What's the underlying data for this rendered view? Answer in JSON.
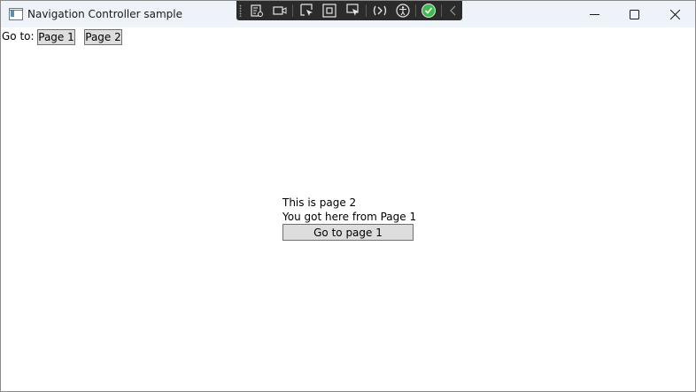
{
  "window": {
    "title": "Navigation Controller sample"
  },
  "debug_toolbar": {
    "icons": [
      "live-visual-tree-icon",
      "record-icon",
      "select-element-icon",
      "display-layout-adorners-icon",
      "track-focus-icon",
      "hot-reload-icon",
      "accessibility-icon",
      "status-ok-icon",
      "collapse-toolbar-icon"
    ],
    "status_color": "#3fb950"
  },
  "caption_buttons": [
    "minimize-icon",
    "maximize-icon",
    "close-icon"
  ],
  "nav": {
    "label": "Go to:",
    "page1_button": "Page 1",
    "page2_button": "Page 2"
  },
  "page": {
    "heading": "This is page 2",
    "origin_text": "You got here from Page 1",
    "goto_button": "Go to page 1"
  }
}
